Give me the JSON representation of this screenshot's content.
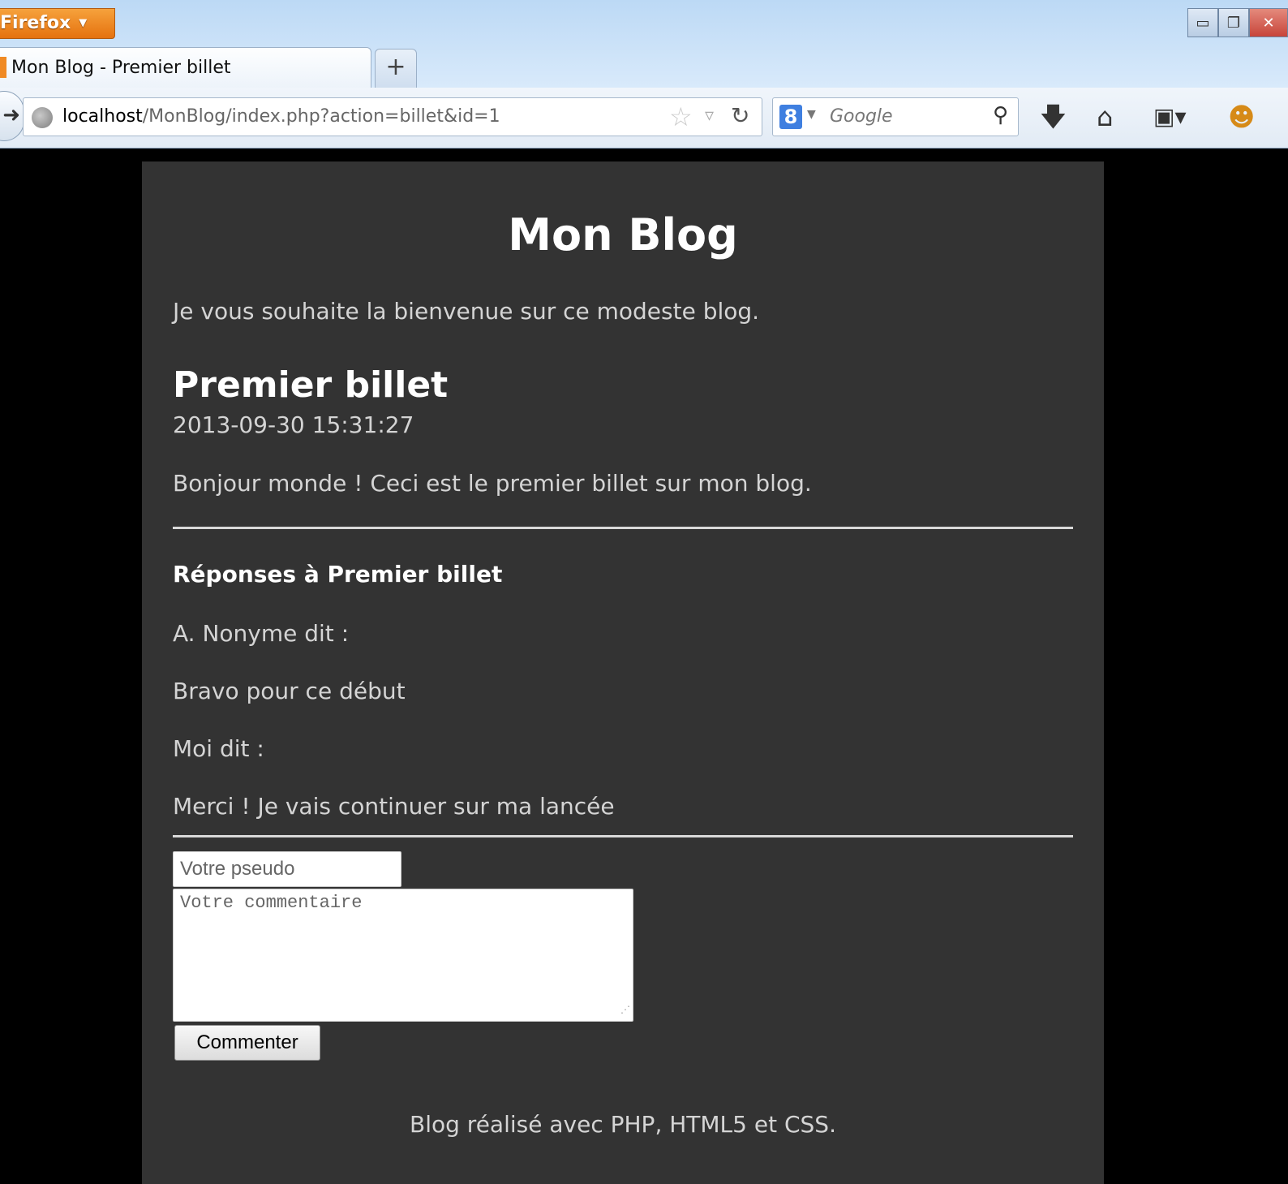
{
  "browser": {
    "app_button_label": "Firefox",
    "tab_title": "Mon Blog - Premier billet",
    "new_tab_label": "+",
    "url_host": "localhost",
    "url_path": "/MonBlog/index.php?action=billet&id=1",
    "search_engine_letter": "8",
    "search_placeholder": "Google",
    "icons": [
      "back-arrow-icon",
      "globe-icon",
      "bookmark-star-icon",
      "reload-icon",
      "search-icon",
      "download-icon",
      "home-icon",
      "bookmarks-menu-icon",
      "addon-icon"
    ]
  },
  "blog": {
    "title": "Mon Blog",
    "subtitle": "Je vous souhaite la bienvenue sur ce modeste blog."
  },
  "post": {
    "title": "Premier billet",
    "date": "2013-09-30 15:31:27",
    "content": "Bonjour monde ! Ceci est le premier billet sur mon blog."
  },
  "replies": {
    "heading": "Réponses à Premier billet",
    "comments": [
      {
        "author_line": "A. Nonyme dit :",
        "text": "Bravo pour ce début"
      },
      {
        "author_line": "Moi dit :",
        "text": "Merci ! Je vais continuer sur ma lancée"
      }
    ]
  },
  "form": {
    "pseudo_placeholder": "Votre pseudo",
    "comment_placeholder": "Votre commentaire",
    "submit_label": "Commenter"
  },
  "footer": {
    "text": "Blog réalisé avec PHP, HTML5 et CSS."
  },
  "colors": {
    "page_background": "#000000",
    "content_background": "#333333",
    "text": "#d4d4d4",
    "firefox_button": "#e5720f"
  }
}
